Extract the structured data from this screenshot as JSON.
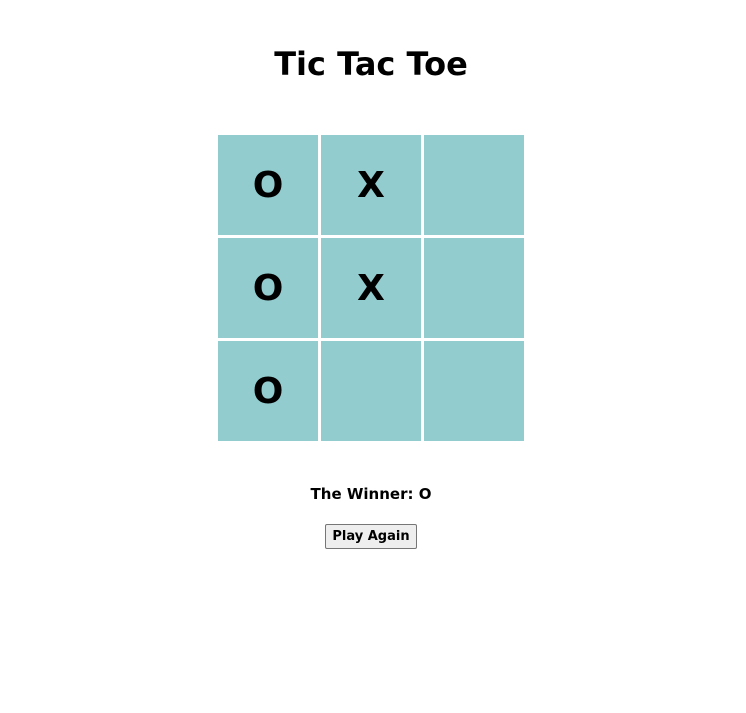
{
  "game": {
    "title": "Tic Tac Toe",
    "board": [
      [
        "O",
        "X",
        ""
      ],
      [
        "O",
        "X",
        ""
      ],
      [
        "O",
        "",
        ""
      ]
    ],
    "winner_text": "The Winner: O",
    "play_again_label": "Play Again"
  },
  "colors": {
    "cell_background": "#92cccf",
    "page_background": "#ffffff"
  }
}
